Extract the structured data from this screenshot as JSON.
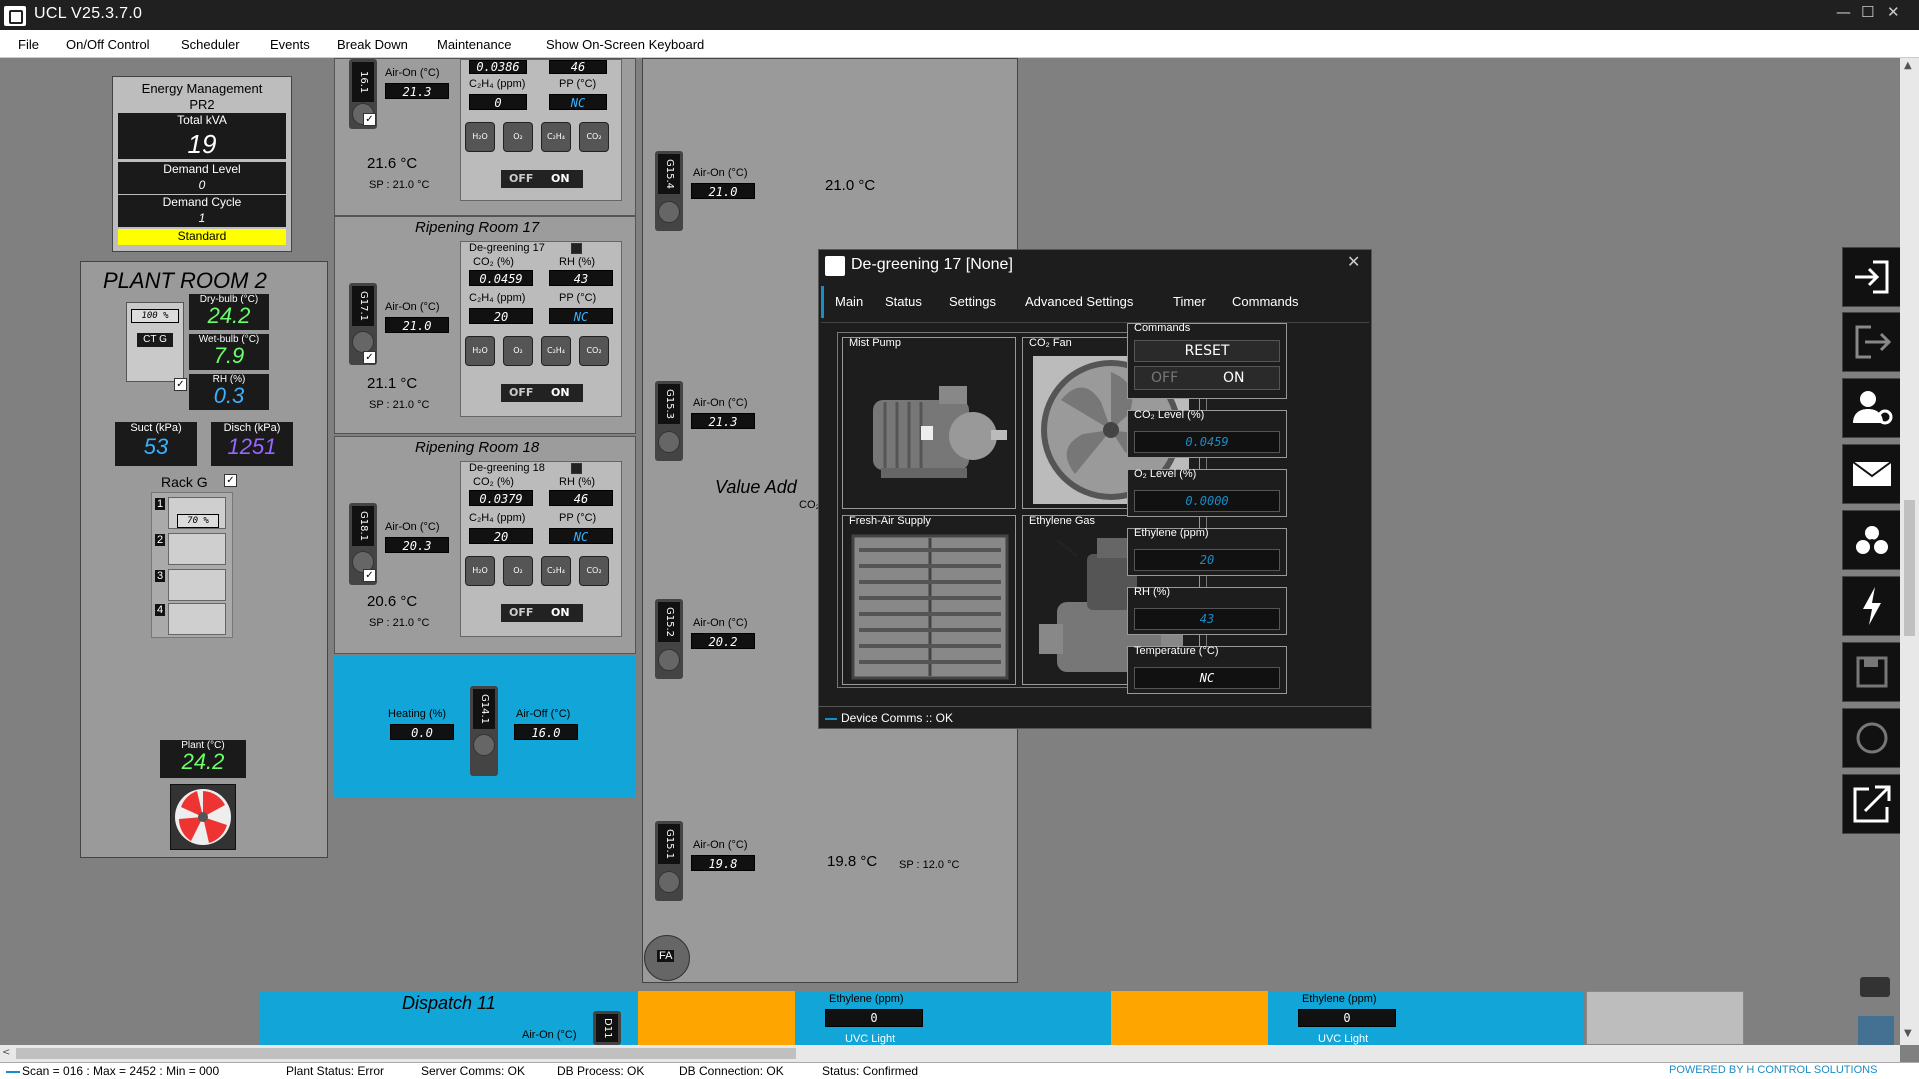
{
  "window": {
    "title": "UCL V25.3.7.0",
    "min": "—",
    "max": "☐",
    "close": "✕"
  },
  "menu": [
    "File",
    "On/Off Control",
    "Scheduler",
    "Events",
    "Break Down",
    "Maintenance",
    "Show On-Screen Keyboard"
  ],
  "energy": {
    "title": "Energy Management",
    "subtitle": "PR2",
    "total_label": "Total kVA",
    "total_value": "19",
    "demand_level_label": "Demand Level",
    "demand_level_value": "0",
    "demand_cycle_label": "Demand Cycle",
    "demand_cycle_value": "1",
    "mode": "Standard"
  },
  "plant": {
    "title": "PLANT ROOM 2",
    "ct_label": "CT G",
    "ct_pct": "100",
    "pct_unit": "%",
    "dry_label": "Dry-bulb (°C)",
    "dry_value": "24.2",
    "wet_label": "Wet-bulb (°C)",
    "wet_value": "7.9",
    "rh_label": "RH (%)",
    "rh_value": "0.3",
    "suct_label": "Suct (kPa)",
    "suct_value": "53",
    "disch_label": "Disch (kPa)",
    "disch_value": "1251",
    "rack_label": "Rack G",
    "rack_pct": "70",
    "rack_nums": [
      "1",
      "2",
      "3",
      "4"
    ],
    "plant_label": "Plant (°C)",
    "plant_value": "24.2"
  },
  "room16": {
    "tag": "16.1",
    "airon_label": "Air-On (°C)",
    "airon": "21.3",
    "co2": "0.0386",
    "rh": "46",
    "c2h4_label": "C₂H₄ (ppm)",
    "c2h4": "0",
    "pp_label": "PP (°C)",
    "pp": "NC",
    "temp": "21.6 °C",
    "sp": "SP : 21.0 °C",
    "icons": [
      "H₂O",
      "O₂",
      "C₂H₄",
      "CO₂"
    ],
    "off": "OFF",
    "on": "ON"
  },
  "room17": {
    "title": "Ripening Room 17",
    "degreening": "De-greening 17",
    "tag": "G17.1",
    "co2_label": "CO₂ (%)",
    "co2": "0.0459",
    "rh_label": "RH (%)",
    "rh": "43",
    "c2h4_label": "C₂H₄ (ppm)",
    "c2h4": "20",
    "pp_label": "PP (°C)",
    "pp": "NC",
    "airon_label": "Air-On (°C)",
    "airon": "21.0",
    "temp": "21.1 °C",
    "sp": "SP : 21.0 °C",
    "off": "OFF",
    "on": "ON"
  },
  "room18": {
    "title": "Ripening Room 18",
    "degreening": "De-greening 18",
    "tag": "G18.1",
    "co2_label": "CO₂ (%)",
    "co2": "0.0379",
    "rh_label": "RH (%)",
    "rh": "46",
    "c2h4_label": "C₂H₄ (ppm)",
    "c2h4": "20",
    "pp_label": "PP (°C)",
    "pp": "NC",
    "airon_label": "Air-On (°C)",
    "airon": "20.3",
    "temp": "20.6 °C",
    "sp": "SP : 21.0 °C",
    "off": "OFF",
    "on": "ON"
  },
  "heating": {
    "tag": "G14.1",
    "heating_label": "Heating (%)",
    "heating": "0.0",
    "airoff_label": "Air-Off (°C)",
    "airoff": "16.0"
  },
  "g15": [
    {
      "tag": "G15.4",
      "label": "Air-On (°C)",
      "value": "21.0"
    },
    {
      "tag": "G15.3",
      "label": "Air-On (°C)",
      "value": "21.3"
    },
    {
      "tag": "G15.2",
      "label": "Air-On (°C)",
      "value": "20.2"
    },
    {
      "tag": "G15.1",
      "label": "Air-On (°C)",
      "value": "19.8"
    }
  ],
  "value_add": {
    "title": "Value Add",
    "co2": "CO₂",
    "temp": "19.8 °C",
    "sp": "SP : 12.0 °C",
    "fa": "FA",
    "partial": "21.0 °C"
  },
  "dispatch": {
    "title": "Dispatch 11",
    "airon_label": "Air-On (°C)",
    "tag": "D11",
    "eth_label": "Ethylene (ppm)",
    "eth1": "0",
    "eth2": "0",
    "uvc": "UVC Light"
  },
  "dialog": {
    "title": "De-greening 17 [None]",
    "tabs": [
      "Main",
      "Status",
      "Settings",
      "Advanced Settings",
      "Timer",
      "Commands"
    ],
    "panels": [
      "Mist Pump",
      "CO₂ Fan",
      "Fresh-Air Supply",
      "Ethylene Gas"
    ],
    "commands": {
      "label": "Commands",
      "reset": "RESET",
      "off": "OFF",
      "on": "ON"
    },
    "readings": [
      {
        "label": "CO₂ Level (%)",
        "value": "0.0459",
        "color": "#1a8cc9"
      },
      {
        "label": "O₂ Level (%)",
        "value": "0.0000",
        "color": "#1a8cc9"
      },
      {
        "label": "Ethylene (ppm)",
        "value": "20",
        "color": "#1a8cc9"
      },
      {
        "label": "RH (%)",
        "value": "43",
        "color": "#1a8cc9"
      },
      {
        "label": "Temperature (°C)",
        "value": "NC",
        "color": "#ffffff"
      }
    ],
    "comms": "Device Comms :: OK"
  },
  "sidebar_icons": [
    "login-icon",
    "logout-icon",
    "user-settings-icon",
    "mail-icon",
    "biohazard-icon",
    "power-icon",
    "save-icon",
    "refresh-icon",
    "external-link-icon"
  ],
  "status": {
    "scan": "Scan = 016 : Max = 2452 : Min = 000",
    "plant": "Plant Status: Error",
    "server": "Server Comms: OK",
    "dbproc": "DB Process:  OK",
    "dbconn": "DB Connection:  OK",
    "status": "Status:  Confirmed",
    "powered": "POWERED BY H CONTROL SOLUTIONS"
  },
  "colors": {
    "accent_blue": "#12a6d8",
    "orange": "#ffa500",
    "standard_yellow": "#ffff00",
    "value_green": "#6aff6a",
    "value_blue": "#3ab0ff",
    "value_purple": "#9966ff"
  }
}
